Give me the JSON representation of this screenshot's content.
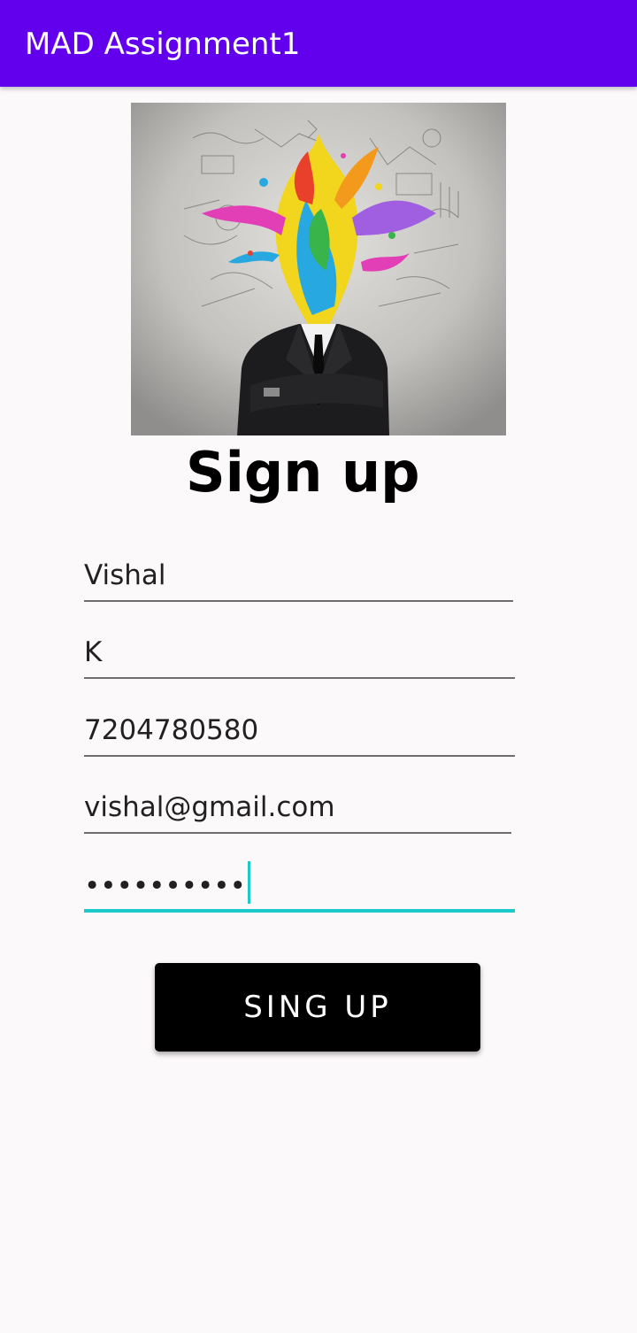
{
  "app_bar": {
    "title": "MAD Assignment1",
    "color": "#6200ee"
  },
  "hero_image": {
    "name": "creative-businessman-paint-splash-image"
  },
  "form": {
    "heading": "Sign up",
    "fields": [
      {
        "name": "first-name",
        "value": "Vishal"
      },
      {
        "name": "last-name",
        "value": "K"
      },
      {
        "name": "phone",
        "value": "7204780580"
      },
      {
        "name": "email",
        "value": "vishal@gmail.com"
      },
      {
        "name": "password",
        "value": "••••••••••",
        "focused": true
      }
    ],
    "accent_color": "#1ecac9",
    "submit_label": "SING UP"
  }
}
